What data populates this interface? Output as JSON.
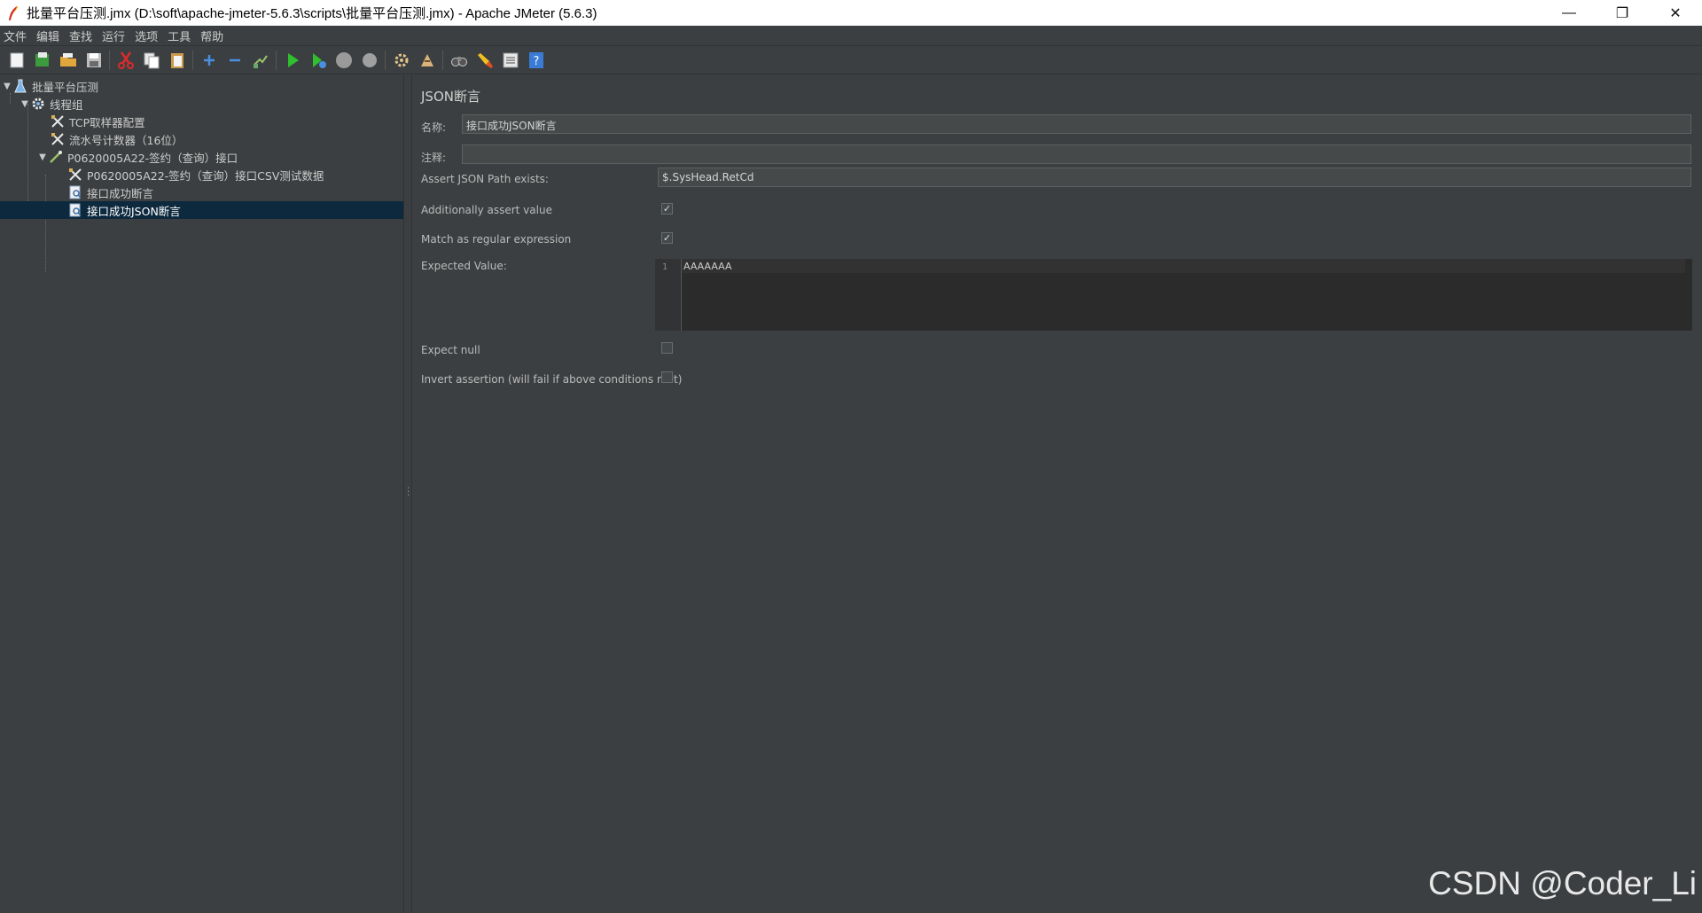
{
  "window": {
    "title": "批量平台压测.jmx (D:\\soft\\apache-jmeter-5.6.3\\scripts\\批量平台压测.jmx) - Apache JMeter (5.6.3)",
    "controls": {
      "minimize": "—",
      "maximize": "❐",
      "close": "✕"
    }
  },
  "menu": [
    "文件",
    "编辑",
    "查找",
    "运行",
    "选项",
    "工具",
    "帮助"
  ],
  "toolbar": [
    {
      "name": "new-icon"
    },
    {
      "name": "templates-icon"
    },
    {
      "name": "open-icon"
    },
    {
      "name": "save-icon"
    },
    {
      "name": "cut-icon"
    },
    {
      "name": "copy-icon"
    },
    {
      "name": "paste-icon"
    },
    {
      "name": "expand-icon"
    },
    {
      "name": "collapse-icon"
    },
    {
      "name": "toggle-icon"
    },
    {
      "name": "start-icon"
    },
    {
      "name": "start-no-pause-icon"
    },
    {
      "name": "stop-icon"
    },
    {
      "name": "shutdown-icon"
    },
    {
      "name": "remote-start-icon"
    },
    {
      "name": "remote-stop-icon"
    },
    {
      "name": "search-binoculars-icon"
    },
    {
      "name": "clear-all-icon"
    },
    {
      "name": "function-helper-icon"
    },
    {
      "name": "help-icon"
    }
  ],
  "tree": {
    "items": [
      {
        "label": "批量平台压测",
        "icon": "test-plan-icon"
      },
      {
        "label": "线程组",
        "icon": "thread-group-icon"
      },
      {
        "label": "TCP取样器配置",
        "icon": "config-icon"
      },
      {
        "label": "流水号计数器（16位）",
        "icon": "config-icon"
      },
      {
        "label": "P0620005A22-签约（查询）接口",
        "icon": "sampler-icon"
      },
      {
        "label": "P0620005A22-签约（查询）接口CSV测试数据",
        "icon": "config-icon"
      },
      {
        "label": "接口成功断言",
        "icon": "assertion-icon"
      },
      {
        "label": "接口成功JSON断言",
        "icon": "assertion-icon"
      }
    ]
  },
  "panel": {
    "title": "JSON断言",
    "name_label": "名称:",
    "name_value": "接口成功JSON断言",
    "comment_label": "注释:",
    "comment_value": "",
    "path_label": "Assert JSON Path exists:",
    "path_value": "$.SysHead.RetCd",
    "additionally_label": "Additionally assert value",
    "additionally_checked": true,
    "regex_label": "Match as regular expression",
    "regex_checked": true,
    "expected_label": "Expected Value:",
    "expected_line_no": "1",
    "expected_value": "AAAAAAA",
    "expect_null_label": "Expect null",
    "expect_null_checked": false,
    "invert_label": "Invert assertion (will fail if above conditions met)",
    "invert_checked": false
  },
  "watermark": "CSDN @Coder_Li"
}
